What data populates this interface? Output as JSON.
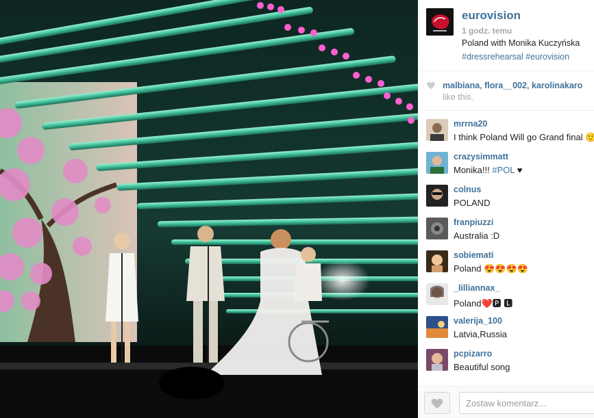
{
  "post": {
    "username": "eurovision",
    "timestamp": "1 godz. temu",
    "caption": "Poland with Monika Kuczyńska",
    "hashtags": "#dressrehearsal #eurovision"
  },
  "likes": {
    "user1": "malbiana",
    "sep1": ", ",
    "user2": "flora__002",
    "sep2": ", ",
    "user3": "karolinakaro",
    "suffix": "like this."
  },
  "comments": [
    {
      "user": "mrrna20",
      "text": "I think Poland Will go Grand final 🙂"
    },
    {
      "user": "crazysimmatt",
      "text_before": "Monika!!! ",
      "tag": "#POL",
      "text_after": " ♥"
    },
    {
      "user": "colnus",
      "text": "POLAND"
    },
    {
      "user": "franpiuzzi",
      "text": "Australia :D"
    },
    {
      "user": "sobiemati",
      "text": "Poland 😍😍😍😍"
    },
    {
      "user": "_lilliannax_",
      "text": "Poland❤️🅿 🅻"
    },
    {
      "user": "valerija_100",
      "text": "Latvia,Russia"
    },
    {
      "user": "pcpizarro",
      "text": "Beautiful song"
    }
  ],
  "footer": {
    "comment_placeholder": "Zostaw komentarz..."
  },
  "icons": {
    "heart": "heart-icon"
  },
  "colors": {
    "link": "#3f729b",
    "stage_green": "#3fbf9a",
    "stage_pink": "#ff5fd0"
  }
}
